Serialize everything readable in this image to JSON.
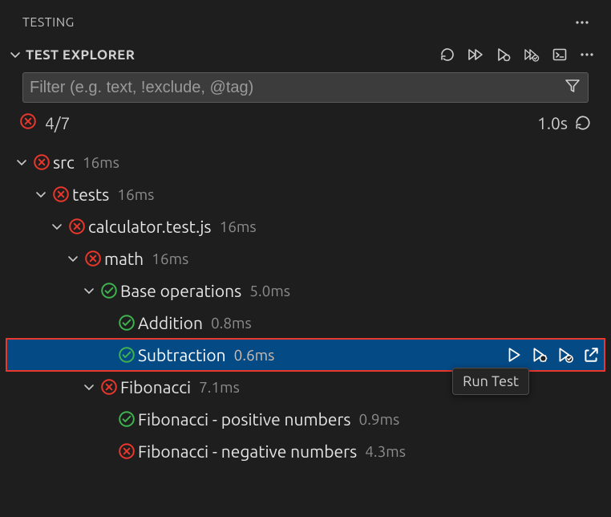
{
  "panel": {
    "title": "TESTING"
  },
  "section": {
    "title": "TEST EXPLORER"
  },
  "filter": {
    "placeholder": "Filter (e.g. text, !exclude, @tag)"
  },
  "summary": {
    "count": "4/7",
    "duration": "1.0s"
  },
  "tooltip": "Run Test",
  "tree": {
    "src": {
      "label": "src",
      "duration": "16ms",
      "status": "fail",
      "expanded": true
    },
    "tests": {
      "label": "tests",
      "duration": "16ms",
      "status": "fail",
      "expanded": true
    },
    "calc": {
      "label": "calculator.test.js",
      "duration": "16ms",
      "status": "fail",
      "expanded": true
    },
    "math": {
      "label": "math",
      "duration": "16ms",
      "status": "fail",
      "expanded": true
    },
    "baseops": {
      "label": "Base operations",
      "duration": "5.0ms",
      "status": "pass",
      "expanded": true
    },
    "addition": {
      "label": "Addition",
      "duration": "0.8ms",
      "status": "pass"
    },
    "subtraction": {
      "label": "Subtraction",
      "duration": "0.6ms",
      "status": "pass"
    },
    "fibonacci": {
      "label": "Fibonacci",
      "duration": "7.1ms",
      "status": "fail",
      "expanded": true
    },
    "fib_pos": {
      "label": "Fibonacci - positive numbers",
      "duration": "0.9ms",
      "status": "pass"
    },
    "fib_neg": {
      "label": "Fibonacci - negative numbers",
      "duration": "4.3ms",
      "status": "fail"
    }
  }
}
